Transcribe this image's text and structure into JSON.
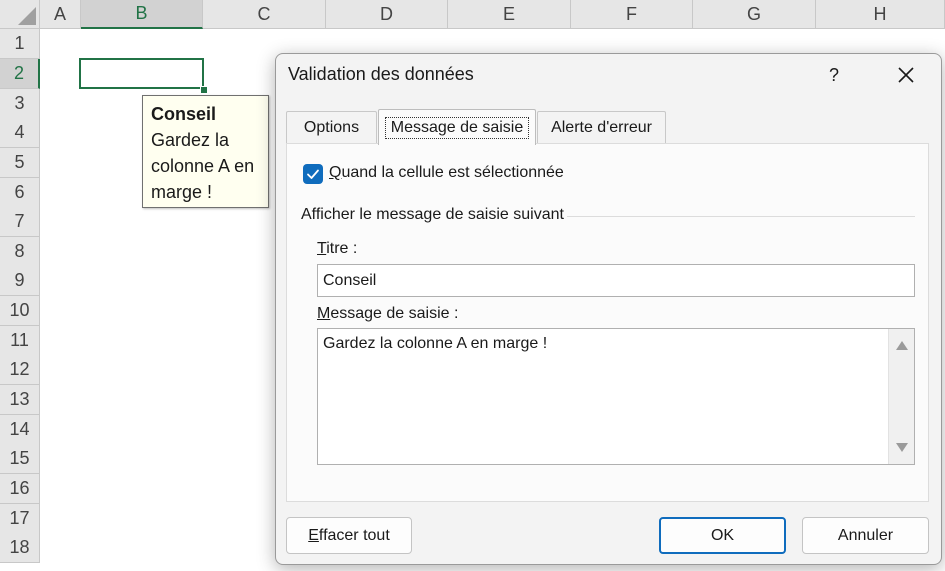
{
  "sheet": {
    "columns": [
      "A",
      "B",
      "C",
      "D",
      "E",
      "F",
      "G",
      "H"
    ],
    "rows": [
      "1",
      "2",
      "3",
      "4",
      "5",
      "6",
      "7",
      "8",
      "9",
      "10",
      "11",
      "12",
      "13",
      "14",
      "15",
      "16",
      "17",
      "18"
    ],
    "active_column": "B",
    "active_row": "2",
    "accent_color": "#217346"
  },
  "input_tooltip": {
    "title": "Conseil",
    "message": "Gardez la colonne A en marge !"
  },
  "dialog": {
    "title": "Validation des données",
    "help_label": "?",
    "tabs": [
      {
        "label": "Options",
        "active": false
      },
      {
        "label": "Message de saisie",
        "active": true
      },
      {
        "label": "Alerte d'erreur",
        "active": false
      }
    ],
    "show_message_checkbox": {
      "checked": true,
      "label_key": "Q",
      "label_rest": "uand la cellule est sélectionnée"
    },
    "group_label": "Afficher le message de saisie suivant",
    "title_field": {
      "label_key": "T",
      "label_rest": "itre :",
      "value": "Conseil"
    },
    "message_field": {
      "label_key": "M",
      "label_rest": "essage de saisie :",
      "value": "Gardez la colonne A en marge !"
    },
    "buttons": {
      "clear_key": "E",
      "clear_rest": "ffacer tout",
      "ok": "OK",
      "cancel": "Annuler"
    },
    "accent_color": "#0f6cbd"
  }
}
